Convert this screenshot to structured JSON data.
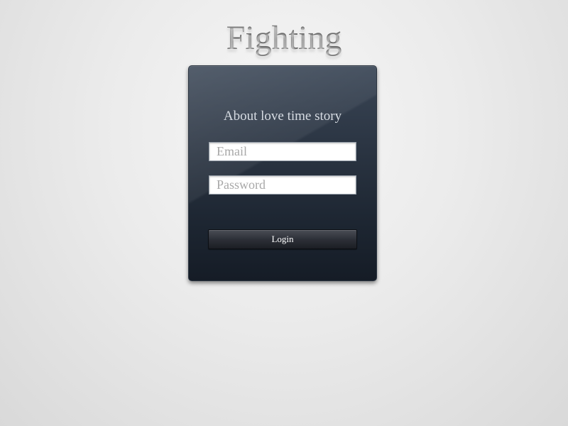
{
  "page": {
    "title": "Fighting"
  },
  "login_panel": {
    "subtitle": "About love time story",
    "email": {
      "placeholder": "Email",
      "value": ""
    },
    "password": {
      "placeholder": "Password",
      "value": ""
    },
    "login_label": "Login"
  },
  "colors": {
    "panel_top": "#3a4656",
    "panel_bottom": "#151c26",
    "background": "#ebebeb",
    "title": "#5a5a5a"
  }
}
